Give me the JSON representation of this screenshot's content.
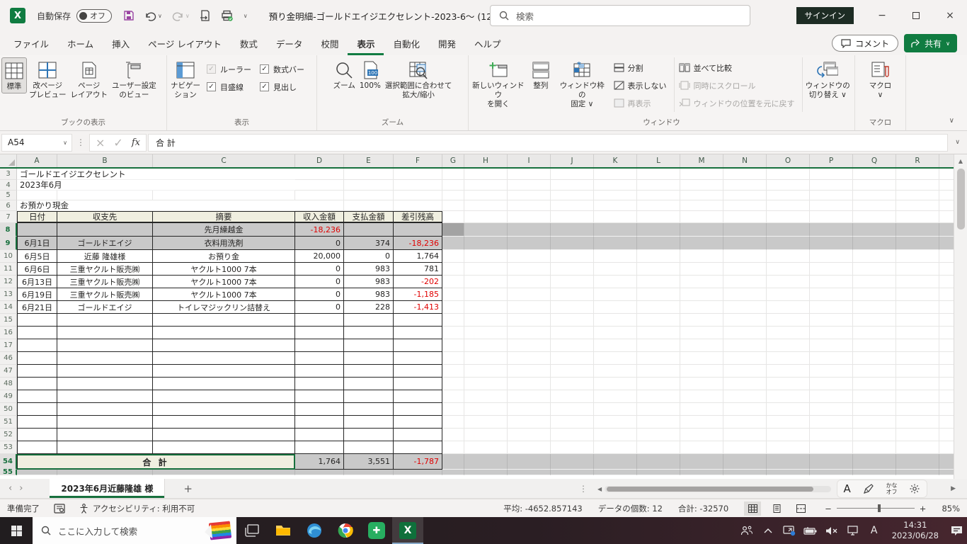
{
  "titlebar": {
    "autosave_label": "自動保存",
    "autosave_state": "オフ",
    "title": "預り金明細-ゴールドエイジエクセレント-2023-6〜 (12… ",
    "search_placeholder": "検索",
    "signin": "サインイン"
  },
  "ribbon": {
    "tabs": [
      {
        "id": "file",
        "label": "ファイル",
        "active": false
      },
      {
        "id": "home",
        "label": "ホーム",
        "active": false
      },
      {
        "id": "insert",
        "label": "挿入",
        "active": false
      },
      {
        "id": "page-layout",
        "label": "ページ レイアウト",
        "active": false
      },
      {
        "id": "formulas",
        "label": "数式",
        "active": false
      },
      {
        "id": "data",
        "label": "データ",
        "active": false
      },
      {
        "id": "review",
        "label": "校閲",
        "active": false
      },
      {
        "id": "view",
        "label": "表示",
        "active": true
      },
      {
        "id": "automate",
        "label": "自動化",
        "active": false
      },
      {
        "id": "developer",
        "label": "開発",
        "active": false
      },
      {
        "id": "help",
        "label": "ヘルプ",
        "active": false
      }
    ],
    "comment": "コメント",
    "share": "共有"
  },
  "view_tab": {
    "book_views": {
      "label": "ブックの表示",
      "normal": "標準",
      "page_break_preview": "改ページ\nプレビュー",
      "page_layout": "ページ\nレイアウト",
      "custom_views": "ユーザー設定\nのビュー"
    },
    "show": {
      "label": "表示",
      "navigation": "ナビゲー\nション",
      "ruler": "ルーラー",
      "formula_bar": "数式バー",
      "gridlines": "目盛線",
      "headings": "見出し"
    },
    "zoom": {
      "label": "ズーム",
      "zoom": "ズーム",
      "hundred": "100%",
      "zoom_to_selection": "選択範囲に合わせて\n拡大/縮小"
    },
    "window": {
      "label": "ウィンドウ",
      "new_window": "新しいウィンドウ\nを開く",
      "arrange_all": "整列",
      "freeze_panes": "ウィンドウ枠の\n固定 ∨",
      "split": "分割",
      "hide": "表示しない",
      "unhide": "再表示",
      "view_side_by_side": "並べて比較",
      "synchronous_scrolling": "同時にスクロール",
      "reset_window_position": "ウィンドウの位置を元に戻す",
      "switch_windows": "ウィンドウの\n切り替え ∨"
    },
    "macros": {
      "label": "マクロ",
      "macros": "マクロ\n∨"
    }
  },
  "formula_bar": {
    "name_box": "A54",
    "formula": "合 計"
  },
  "sheet": {
    "col_headers": [
      "A",
      "B",
      "C",
      "D",
      "E",
      "F",
      "G",
      "H",
      "I",
      "J",
      "K",
      "L",
      "M",
      "N",
      "O",
      "P",
      "Q",
      "R"
    ],
    "rows": [
      {
        "num": "3",
        "label": "ゴールドエイジエクセレント"
      },
      {
        "num": "4",
        "label": "2023年6月"
      },
      {
        "num": "5"
      },
      {
        "num": "6",
        "label": "お預かり現金"
      },
      {
        "num": "7",
        "header": [
          "日付",
          "収支先",
          "摘要",
          "収入金額",
          "支払金額",
          "差引残高"
        ]
      },
      {
        "num": "8",
        "selected": true,
        "cells": [
          "",
          "",
          "先月繰越金",
          "-18,236",
          "",
          ""
        ],
        "red": [
          3
        ]
      },
      {
        "num": "9",
        "selected": true,
        "cells": [
          "6月1日",
          "ゴールドエイジ",
          "衣料用洗剤",
          "0",
          "374",
          "-18,236"
        ],
        "red": [
          5
        ]
      },
      {
        "num": "10",
        "cells": [
          "6月5日",
          "近藤 隆雄様",
          "お預り金",
          "20,000",
          "0",
          "1,764"
        ]
      },
      {
        "num": "11",
        "cells": [
          "6月6日",
          "三重ヤクルト販売㈱",
          "ヤクルト1000 7本",
          "0",
          "983",
          "781"
        ]
      },
      {
        "num": "12",
        "cells": [
          "6月13日",
          "三重ヤクルト販売㈱",
          "ヤクルト1000 7本",
          "0",
          "983",
          "-202"
        ],
        "red": [
          5
        ]
      },
      {
        "num": "13",
        "cells": [
          "6月19日",
          "三重ヤクルト販売㈱",
          "ヤクルト1000 7本",
          "0",
          "983",
          "-1,185"
        ],
        "red": [
          5
        ]
      },
      {
        "num": "14",
        "cells": [
          "6月21日",
          "ゴールドエイジ",
          "トイレマジックリン詰替え",
          "0",
          "228",
          "-1,413"
        ],
        "red": [
          5
        ]
      },
      {
        "num": "15",
        "cells": [
          "",
          "",
          "",
          "",
          "",
          ""
        ]
      },
      {
        "num": "16",
        "cells": [
          "",
          "",
          "",
          "",
          "",
          ""
        ]
      },
      {
        "num": "17",
        "cells": [
          "",
          "",
          "",
          "",
          "",
          ""
        ]
      },
      {
        "num": "46",
        "cells": [
          "",
          "",
          "",
          "",
          "",
          ""
        ]
      },
      {
        "num": "47",
        "cells": [
          "",
          "",
          "",
          "",
          "",
          ""
        ]
      },
      {
        "num": "48",
        "cells": [
          "",
          "",
          "",
          "",
          "",
          ""
        ]
      },
      {
        "num": "49",
        "cells": [
          "",
          "",
          "",
          "",
          "",
          ""
        ]
      },
      {
        "num": "50",
        "cells": [
          "",
          "",
          "",
          "",
          "",
          ""
        ]
      },
      {
        "num": "51",
        "cells": [
          "",
          "",
          "",
          "",
          "",
          ""
        ]
      },
      {
        "num": "52",
        "cells": [
          "",
          "",
          "",
          "",
          "",
          ""
        ]
      },
      {
        "num": "53",
        "cells": [
          "",
          "",
          "",
          "",
          "",
          ""
        ]
      },
      {
        "num": "54",
        "selected": true,
        "total": "合 計",
        "cells": [
          "1,764",
          "3,551",
          "-1,787"
        ],
        "red": [
          2
        ]
      },
      {
        "num": "55",
        "selected": true
      }
    ]
  },
  "tabbar": {
    "sheet_tab": "2023年6月近藤隆雄 様",
    "ime_a": "A",
    "kana": "かな\nオフ"
  },
  "statusbar": {
    "ready": "準備完了",
    "accessibility": "アクセシビリティ: 利用不可",
    "average": "平均: -4652.857143",
    "count": "データの個数: 12",
    "sum": "合計: -32570",
    "zoom": "85%"
  },
  "taskbar": {
    "search_placeholder": "ここに入力して検索",
    "ime": "A",
    "time": "14:31",
    "date": "2023/06/28"
  },
  "colors": {
    "accent_green": "#107c41",
    "selection_gray": "#c9c9c9",
    "negative_red": "#e00000",
    "header_beige": "#f0efe0"
  }
}
